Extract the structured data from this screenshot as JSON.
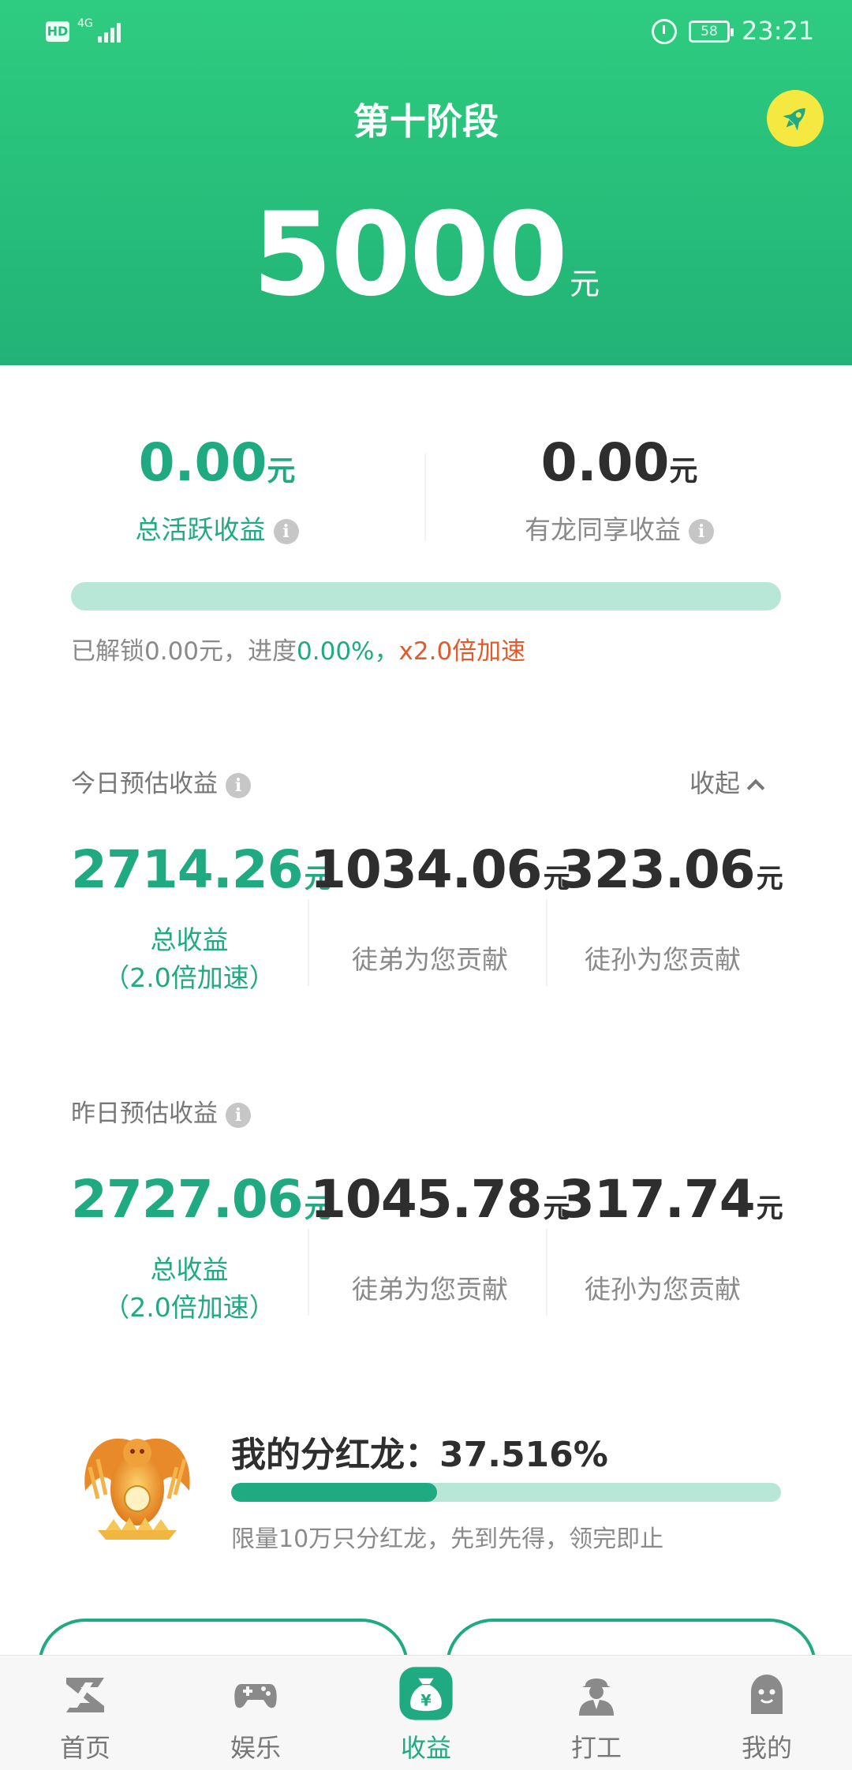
{
  "status_bar": {
    "hd": "HD",
    "network": "4G",
    "battery": "58",
    "time": "23:21"
  },
  "header": {
    "stage_title": "第十阶段",
    "amount": "5000",
    "unit": "元"
  },
  "summary": {
    "active": {
      "value": "0.00",
      "unit": "元",
      "label": "总活跃收益"
    },
    "shared": {
      "value": "0.00",
      "unit": "元",
      "label": "有龙同享收益"
    },
    "progress": 0.0,
    "progress_text_1": "已解锁0.00元，进度",
    "progress_pct": "0.00%",
    "progress_sep": "，",
    "progress_speed": "x2.0倍加速"
  },
  "today": {
    "title": "今日预估收益",
    "collapse": "收起",
    "total": {
      "value": "2714.26",
      "unit": "元",
      "label": "总收益",
      "sublabel": "（2.0倍加速）"
    },
    "apprentice": {
      "value": "1034.06",
      "unit": "元",
      "label": "徒弟为您贡献"
    },
    "grand": {
      "value": "323.06",
      "unit": "元",
      "label": "徒孙为您贡献"
    }
  },
  "yesterday": {
    "title": "昨日预估收益",
    "total": {
      "value": "2727.06",
      "unit": "元",
      "label": "总收益",
      "sublabel": "（2.0倍加速）"
    },
    "apprentice": {
      "value": "1045.78",
      "unit": "元",
      "label": "徒弟为您贡献"
    },
    "grand": {
      "value": "317.74",
      "unit": "元",
      "label": "徒孙为您贡献"
    }
  },
  "dragon": {
    "title": "我的分红龙：37.516%",
    "progress": 0.37516,
    "note": "限量10万只分红龙，先到先得，领完即止",
    "image_label": "分红龙"
  },
  "tabs": [
    {
      "label": "首页",
      "icon": "home-z-icon"
    },
    {
      "label": "娱乐",
      "icon": "gamepad-icon"
    },
    {
      "label": "收益",
      "icon": "money-bag-icon",
      "active": true
    },
    {
      "label": "打工",
      "icon": "worker-icon"
    },
    {
      "label": "我的",
      "icon": "profile-icon"
    }
  ],
  "colors": {
    "primary": "#1faa82",
    "header": "#26bd7a",
    "accent": "#e25a2a",
    "rocket": "#f5e840"
  }
}
